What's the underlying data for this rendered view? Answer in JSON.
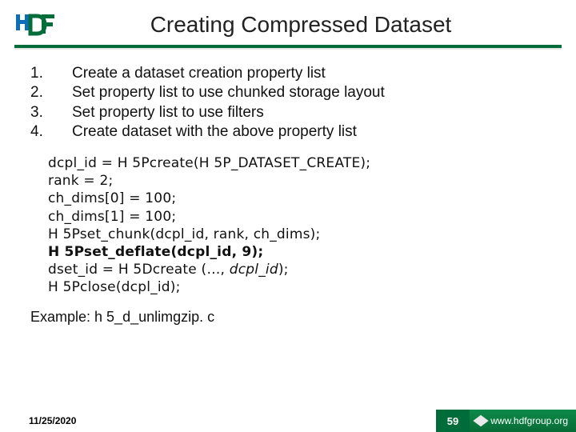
{
  "header": {
    "title": "Creating Compressed Dataset",
    "logo_alt": "HDF logo"
  },
  "steps": [
    "Create a dataset creation property list",
    "Set property list to use chunked storage layout",
    "Set property list to use filters",
    "Create dataset with the above property list"
  ],
  "code": {
    "l1": "dcpl_id = H 5Pcreate(H 5P_DATASET_CREATE);",
    "l2": "rank = 2;",
    "l3": "ch_dims[0] = 100;",
    "l4": "ch_dims[1] = 100;",
    "l5": "H 5Pset_chunk(dcpl_id, rank, ch_dims);",
    "l6": "H 5Pset_deflate(dcpl_id, 9);",
    "l7a": "dset_id = H 5Dcreate (…, ",
    "l7b": "dcpl_id",
    "l7c": ");",
    "l8": "H 5Pclose(dcpl_id);"
  },
  "example_label": "Example: h 5_d_unlimgzip. c",
  "footer": {
    "date": "11/25/2020",
    "page": "59",
    "org": "www.hdfgroup.org"
  }
}
